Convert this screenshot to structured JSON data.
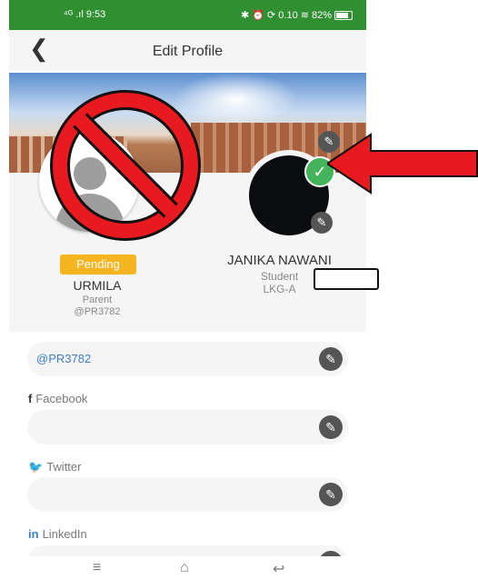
{
  "status_bar": {
    "left": "⁴ᴳ .ıl 9:53",
    "right": "✱ ⏰ ⟳ 0.10 ≋ 82%"
  },
  "header": {
    "back_icon": "chevron-left-icon",
    "title": "Edit Profile"
  },
  "left_profile": {
    "badge": "Pending",
    "name": "URMILA",
    "role": "Parent",
    "handle": "@PR3782"
  },
  "right_profile": {
    "name": "JANIKA NAWANI",
    "role": "Student",
    "class": "LKG-A"
  },
  "fields": [
    {
      "label": "",
      "value": "@PR3782"
    },
    {
      "icon": "f",
      "label": "Facebook",
      "value": ""
    },
    {
      "icon": "🐦",
      "label": "Twitter",
      "value": ""
    },
    {
      "icon": "in",
      "label": "LinkedIn",
      "value": ""
    }
  ],
  "navbar": {
    "menu_icon": "≡",
    "home_icon": "⌂",
    "back_icon": "↩"
  },
  "colors": {
    "status_green": "#2f8f31",
    "pending": "#f4b521",
    "check_green": "#43b45a",
    "annotation_red": "#e8191f",
    "link_blue": "#3f7ecb"
  }
}
